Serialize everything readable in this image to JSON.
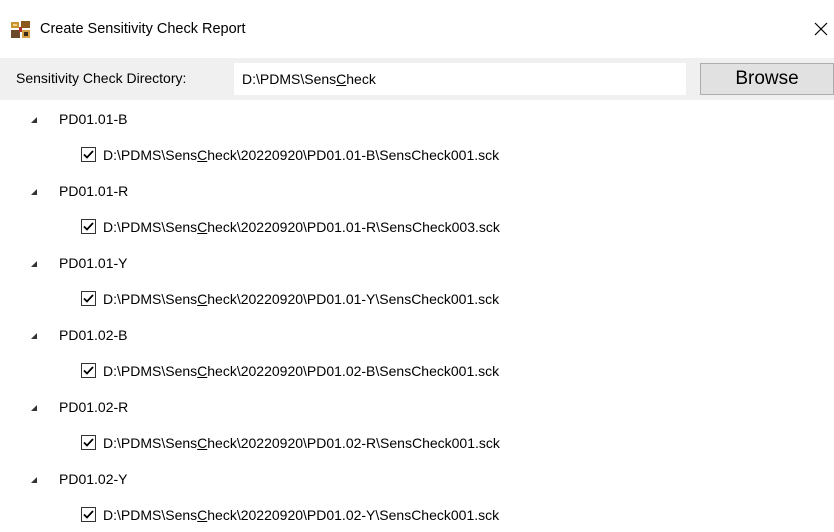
{
  "window": {
    "title": "Create Sensitivity Check Report",
    "close_glyph": "✕",
    "app_icon": "report-app-icon"
  },
  "toolbar": {
    "dir_label": "Sensitivity Check Directory:",
    "dir_value": "D:\\PDMS\\SensCheck",
    "browse_label": "Browse"
  },
  "tree": {
    "groups": [
      {
        "label": "PD01.01-B",
        "expanded": true,
        "files": [
          {
            "path": "D:\\PDMS\\SensCheck\\20220920\\PD01.01-B\\SensCheck001.sck",
            "checked": true
          }
        ]
      },
      {
        "label": "PD01.01-R",
        "expanded": true,
        "files": [
          {
            "path": "D:\\PDMS\\SensCheck\\20220920\\PD01.01-R\\SensCheck003.sck",
            "checked": true
          }
        ]
      },
      {
        "label": "PD01.01-Y",
        "expanded": true,
        "files": [
          {
            "path": "D:\\PDMS\\SensCheck\\20220920\\PD01.01-Y\\SensCheck001.sck",
            "checked": true
          }
        ]
      },
      {
        "label": "PD01.02-B",
        "expanded": true,
        "files": [
          {
            "path": "D:\\PDMS\\SensCheck\\20220920\\PD01.02-B\\SensCheck001.sck",
            "checked": true
          }
        ]
      },
      {
        "label": "PD01.02-R",
        "expanded": true,
        "files": [
          {
            "path": "D:\\PDMS\\SensCheck\\20220920\\PD01.02-R\\SensCheck001.sck",
            "checked": true
          }
        ]
      },
      {
        "label": "PD01.02-Y",
        "expanded": true,
        "files": [
          {
            "path": "D:\\PDMS\\SensCheck\\20220920\\PD01.02-Y\\SensCheck001.sck",
            "checked": true
          }
        ]
      }
    ]
  }
}
